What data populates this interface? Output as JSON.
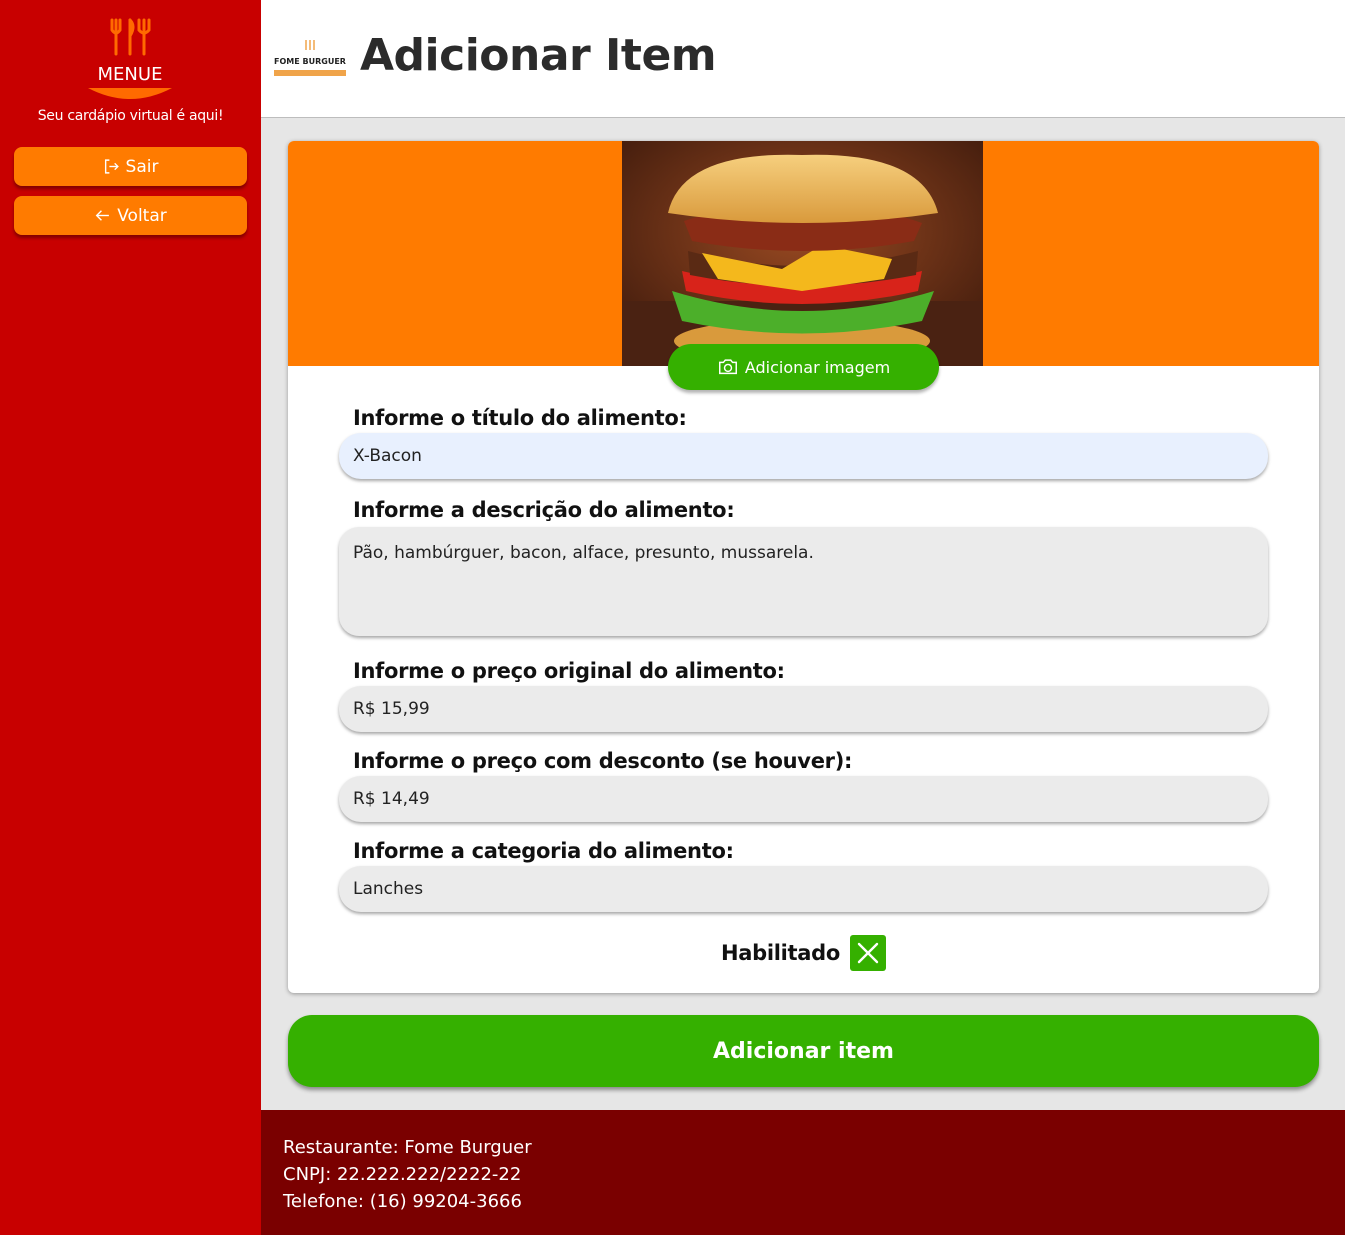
{
  "sidebar": {
    "logo_text": "MENUE",
    "tagline": "Seu cardápio virtual é aqui!",
    "buttons": [
      {
        "label": "Sair",
        "icon": "logout-icon"
      },
      {
        "label": "Voltar",
        "icon": "arrow-left-icon"
      }
    ]
  },
  "header": {
    "brand_logo_text": "FOME BURGUER",
    "title": "Adicionar Item"
  },
  "form": {
    "add_image_label": "Adicionar imagem",
    "fields": {
      "title": {
        "label": "Informe o título do alimento:",
        "value": "X-Bacon"
      },
      "description": {
        "label": "Informe a descrição do alimento:",
        "value": "Pão, hambúrguer, bacon, alface, presunto, mussarela."
      },
      "original_price": {
        "label": "Informe o preço original do alimento:",
        "value": "R$ 15,99"
      },
      "discount_price": {
        "label": "Informe o preço com desconto (se houver):",
        "value": "R$ 14,49"
      },
      "category": {
        "label": "Informe a categoria do alimento:",
        "value": "Lanches"
      }
    },
    "enabled_label": "Habilitado",
    "enabled": true,
    "submit_label": "Adicionar item"
  },
  "footer": {
    "restaurant": "Restaurante: Fome Burguer",
    "cnpj": "CNPJ: 22.222.222/2222-22",
    "phone": "Telefone: (16) 99204-3666"
  },
  "colors": {
    "sidebar": "#c80000",
    "accent_orange": "#ff7b00",
    "accent_green": "#35b000",
    "footer": "#7a0000"
  }
}
